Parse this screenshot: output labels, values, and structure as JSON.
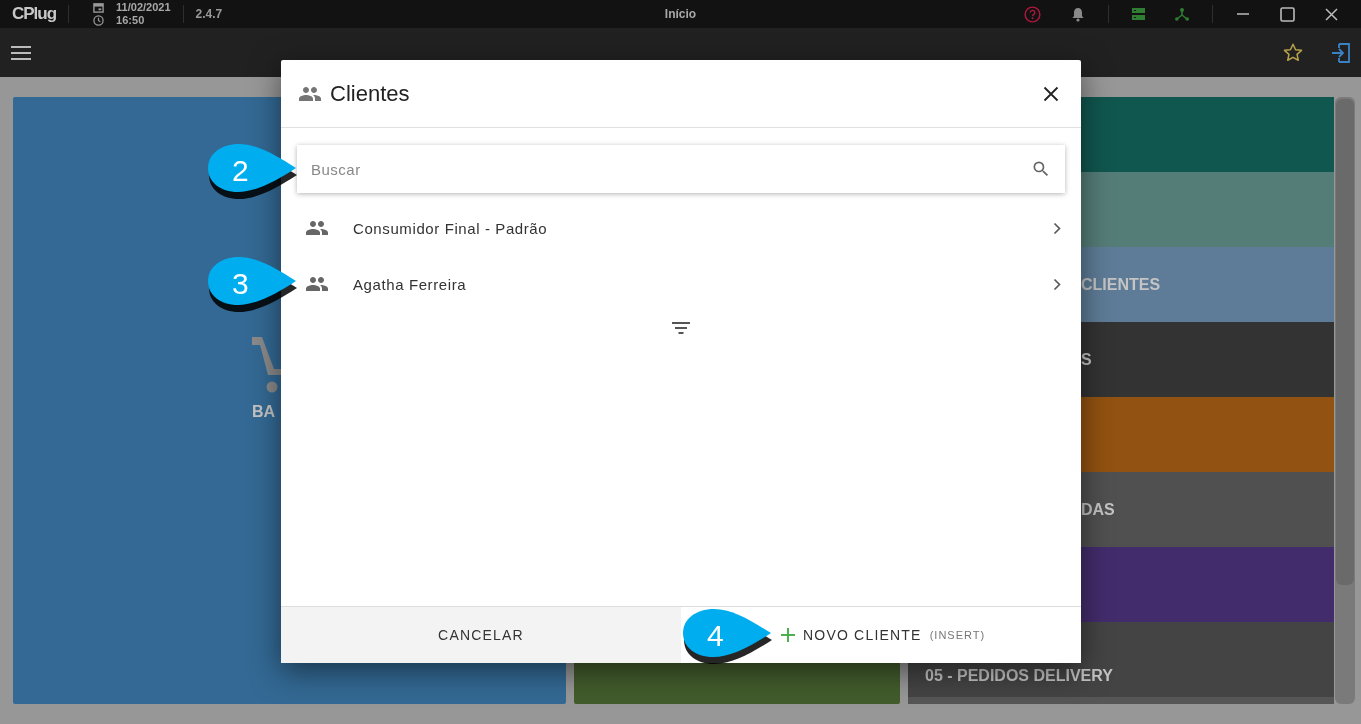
{
  "titlebar": {
    "logo": "CPlug",
    "date": "11/02/2021",
    "time": "16:50",
    "version": "2.4.7",
    "title": "Início"
  },
  "tiles": {
    "left": {
      "label": "BA",
      "color": "#336994"
    },
    "middle": {
      "color": "#425c2c"
    },
    "right": [
      {
        "color": "#10574f"
      },
      {
        "color": "#557d78"
      },
      {
        "color": "#5e7c97",
        "label": "CLIENTES"
      },
      {
        "color": "#333333",
        "label": "S"
      },
      {
        "color": "#925211"
      },
      {
        "color": "#505050",
        "label": "DAS"
      },
      {
        "color": "#432c6c"
      },
      {
        "color": "#444444",
        "label": "05 - PEDIDOS DELIVERY"
      }
    ]
  },
  "dialog": {
    "title": "Clientes",
    "search": {
      "placeholder": "Buscar"
    },
    "clients": [
      {
        "name": "Consumidor Final - Padrão"
      },
      {
        "name": "Agatha Ferreira"
      }
    ],
    "cancel": "CANCELAR",
    "new_client": {
      "label": "NOVO CLIENTE",
      "shortcut": "(INSERT)"
    }
  },
  "callouts": [
    {
      "label": "2"
    },
    {
      "label": "3"
    },
    {
      "label": "4"
    }
  ]
}
